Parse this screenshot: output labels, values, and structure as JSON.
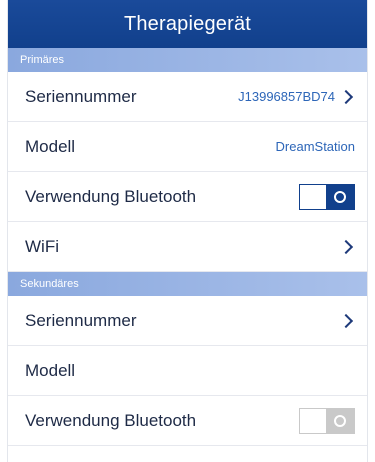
{
  "header": {
    "title": "Therapiegerät"
  },
  "primary": {
    "section_label": "Primäres",
    "serial": {
      "label": "Seriennummer",
      "value": "J13996857BD74"
    },
    "model": {
      "label": "Modell",
      "value": "DreamStation"
    },
    "bluetooth": {
      "label": "Verwendung Bluetooth",
      "enabled": true
    },
    "wifi": {
      "label": "WiFi"
    }
  },
  "secondary": {
    "section_label": "Sekundäres",
    "serial": {
      "label": "Seriennummer"
    },
    "model": {
      "label": "Modell"
    },
    "bluetooth": {
      "label": "Verwendung Bluetooth",
      "enabled": false
    }
  },
  "colors": {
    "header_blue": "#11408c",
    "section_blue": "#8aa8de",
    "value_blue": "#2d66b8",
    "toggle_off": "#c9c9c9"
  }
}
